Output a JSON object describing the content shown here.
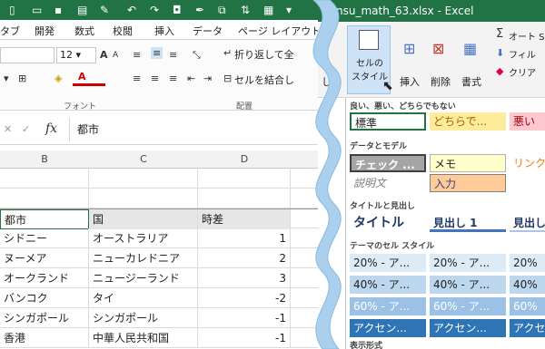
{
  "titlebar": {
    "filename": "nsu_math_63.xlsx - Excel"
  },
  "tabs": [
    "タブ",
    "開発",
    "数式",
    "校閲",
    "挿入",
    "データ",
    "ページ レイアウト"
  ],
  "ribbon": {
    "font_size": "12",
    "wrap_text": "折り返して全",
    "merge_center": "セルを結合し",
    "group_font": "フォント",
    "group_alignment": "配置",
    "cell_styles": "セルの\nスタイル",
    "insert": "挿入",
    "delete": "削除",
    "format": "書式",
    "autosum": "オート SU",
    "fill": "フィル",
    "clear": "クリア",
    "partial_shite": "して"
  },
  "formula_bar": {
    "cancel": "✕",
    "enter": "✓",
    "fx": "fx",
    "value": "都市"
  },
  "columns": [
    "B",
    "C",
    "D"
  ],
  "table": {
    "headers": [
      "都市",
      "国",
      "時差"
    ],
    "rows": [
      [
        "シドニー",
        "オーストラリア",
        "1"
      ],
      [
        "ヌーメア",
        "ニューカレドニア",
        "2"
      ],
      [
        "オークランド",
        "ニュージーランド",
        "3"
      ],
      [
        "バンコク",
        "タイ",
        "-2"
      ],
      [
        "シンガポール",
        "シンガポール",
        "-1"
      ],
      [
        "香港",
        "中華人民共和国",
        "-1"
      ]
    ]
  },
  "gallery": {
    "sec_good": "良い、悪い、どちらでもない",
    "normal": "標準",
    "neutral": "どちらで...",
    "bad": "悪い",
    "sec_data": "データとモデル",
    "check": "チェック ...",
    "memo": "メモ",
    "link": "リンク",
    "explain": "説明文",
    "input": "入力",
    "sec_title": "タイトルと見出し",
    "title": "タイトル",
    "h1": "見出し 1",
    "h2": "見出し",
    "sec_theme": "テーマのセル スタイル",
    "p20a": "20% - ア...",
    "p20b": "20% - ア...",
    "p20c": "20%",
    "p40a": "40% - ア...",
    "p40b": "40% - ア...",
    "p40c": "40%",
    "p60a": "60% - ア...",
    "p60b": "60% - ア...",
    "p60c": "60%",
    "acc1": "アクセン...",
    "acc2": "アクセン...",
    "acc3": "アクセ",
    "sec_number": "表示形式"
  },
  "colors": {
    "excel_green": "#217346",
    "wave": "#aad0ee"
  }
}
